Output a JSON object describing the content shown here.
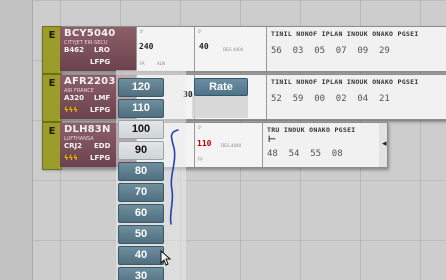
{
  "strips": [
    {
      "tab": "E",
      "callsign": "BCY5040",
      "line2": "CITYJET EIR-SECU",
      "type": "B462",
      "origin": "LRO",
      "dest": "LFPG",
      "cfl": "240",
      "speed": "40",
      "small_label": "FA",
      "small_hint": "ALN",
      "unit_label": "DEG 4404",
      "waypoints": [
        "TINIL",
        "NONOF",
        "IPLAN",
        "INOUK",
        "ONAKO",
        "PGSEI"
      ],
      "times": [
        "56",
        "03",
        "05",
        "07",
        "09",
        "29"
      ]
    },
    {
      "tab": "E",
      "callsign": "AFR2203",
      "line2": "AIR FRANCE",
      "type": "A320",
      "origin": "LMF",
      "dest": "LFPG",
      "cfl": "30",
      "speed": "",
      "small_label": "",
      "small_hint": "",
      "unit_label": "",
      "waypoints": [
        "TINIL",
        "NONOF",
        "IPLAN",
        "INOUK",
        "ONAKO",
        "PGSEI"
      ],
      "times": [
        "52",
        "59",
        "00",
        "02",
        "04",
        "21"
      ]
    },
    {
      "tab": "E",
      "callsign": "DLH83N",
      "line2": "LUFTHANSA",
      "type": "CRJ2",
      "origin": "EDD",
      "dest": "LFPG",
      "cfl": "",
      "speed": "110",
      "small_label": "FP",
      "small_hint": "",
      "unit_label": "DEG 4440",
      "waypoints": [
        "TRU",
        "INOUK",
        "ONAKO",
        "PGSEI"
      ],
      "times": [
        "48",
        "54",
        "55",
        "08"
      ]
    }
  ],
  "rate_button": "Rate",
  "speed_options": [
    "120",
    "110",
    "100",
    "90",
    "80",
    "70",
    "60",
    "50",
    "40",
    "30"
  ],
  "selected_speed": "90",
  "colors": {
    "strip_header": "#7a4f59",
    "tab_olive": "#9c9c2c",
    "speed_button": "#5f8092",
    "pen_stroke": "#2a3fb0",
    "speed_red": "#c00000"
  }
}
